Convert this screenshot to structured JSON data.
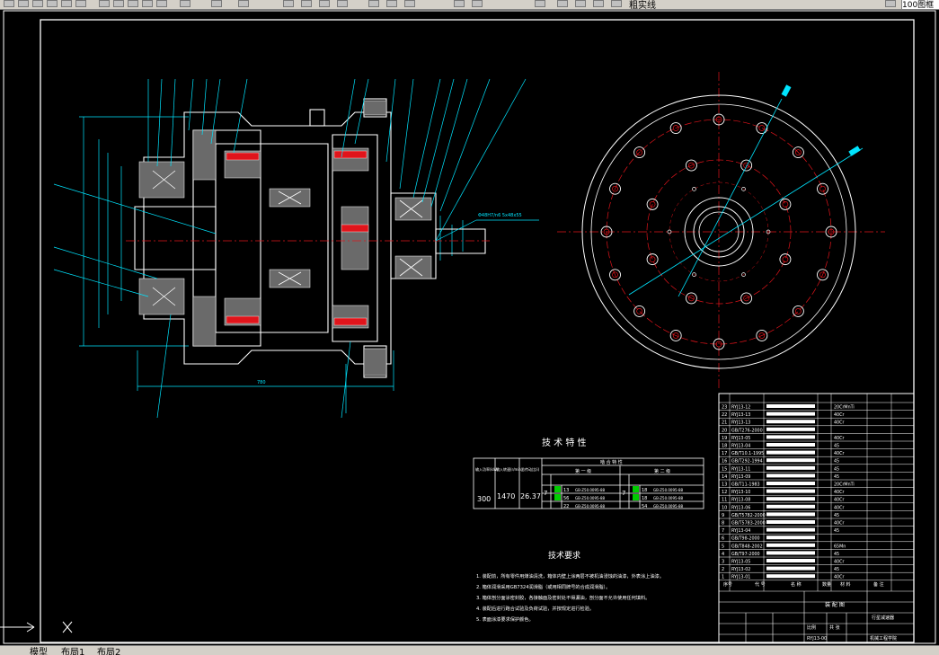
{
  "toolbar": {
    "layer_name": "粗实线",
    "zoom_value": "100图框"
  },
  "tabs": [
    "模型",
    "布局1",
    "布局2"
  ],
  "drawing": {
    "params_title": "技 术 特 性",
    "params_headers": {
      "input_power": "输入功率(kW)",
      "input_speed": "输入转速(r/min)",
      "ratio": "总传动比(i)",
      "meshing": "啮 合 特 性",
      "stage1": "第 一 级",
      "stage2": "第 二 级"
    },
    "params_values": {
      "input_power": "300",
      "input_speed": "1470",
      "ratio": "26.37",
      "stage1_ratio": "7",
      "stage2_ratio": "7",
      "stage1_rows": [
        {
          "z": "13",
          "spec": "GB-Z50.0095-88"
        },
        {
          "z": "56",
          "spec": "GB-Z50.0095-88"
        },
        {
          "z": "22",
          "spec": "GB-Z50.0095-88"
        }
      ],
      "stage2_rows": [
        {
          "z": "18",
          "spec": "GB-Z50.0095-88"
        },
        {
          "z": "18",
          "spec": "GB-Z50.0095-88"
        },
        {
          "z": "54",
          "spec": "GB-Z50.0095-88"
        }
      ]
    },
    "tech_req_title": "技术要求",
    "tech_req_items": [
      "1. 装配前，所有零件用煤油清洗，箱体内壁上涂两层不被机油浸蚀的油漆，外表涂上油漆。",
      "2. 箱体润滑采用GB7324润滑脂（或用相同牌号的合成润滑脂）。",
      "3. 箱体剖分面涂密封胶，各接触面及密封处不得漏油，剖分面不允许使用任何填料。",
      "4. 装配后进行跑合试验及负荷试验，并按规定进行检验。",
      "5. 表面涂漆要求保护颜色。"
    ],
    "leader_annotation": "Φ48H7/n6  5x48x55",
    "dimension_labels": [
      "780",
      "2"
    ],
    "bom_rows": [
      {
        "no": "23",
        "code": "RYJ13-12",
        "material": "20CrMnTi"
      },
      {
        "no": "22",
        "code": "RYJ13-13",
        "material": "40Cr"
      },
      {
        "no": "21",
        "code": "RYJ13-13",
        "material": "40Cr"
      },
      {
        "no": "20",
        "code": "GB/T276-2000",
        "material": ""
      },
      {
        "no": "19",
        "code": "RYJ13-05",
        "material": "40Cr"
      },
      {
        "no": "18",
        "code": "RYJ13-04",
        "material": "45"
      },
      {
        "no": "17",
        "code": "GB/T10.1-1995",
        "material": "40Cr"
      },
      {
        "no": "16",
        "code": "GB/T292-1994",
        "material": "45"
      },
      {
        "no": "15",
        "code": "RYJ13-11",
        "material": "45"
      },
      {
        "no": "14",
        "code": "RYJ13-09",
        "material": "45"
      },
      {
        "no": "13",
        "code": "GB/T11-1983",
        "material": "20CrMnTi"
      },
      {
        "no": "12",
        "code": "RYJ13-10",
        "material": "40Cr"
      },
      {
        "no": "11",
        "code": "RYJ13-08",
        "material": "40Cr"
      },
      {
        "no": "10",
        "code": "RYJ13-06",
        "material": "40Cr"
      },
      {
        "no": "9",
        "code": "GB/T5782-2000",
        "material": "45"
      },
      {
        "no": "8",
        "code": "GB/T5783-2000",
        "material": "40Cr"
      },
      {
        "no": "7",
        "code": "RYJ13-04",
        "material": "45"
      },
      {
        "no": "6",
        "code": "GB/T98-2000",
        "material": ""
      },
      {
        "no": "5",
        "code": "GB/T848-2002",
        "material": "65Mn"
      },
      {
        "no": "4",
        "code": "GB/T97-2000",
        "material": "45"
      },
      {
        "no": "3",
        "code": "RYJ13-05",
        "material": "40Cr"
      },
      {
        "no": "2",
        "code": "RYJ13-02",
        "material": "45"
      },
      {
        "no": "1",
        "code": "RYJ13-01",
        "material": "40Cr"
      }
    ],
    "bom_header": {
      "no": "序号",
      "code": "代 号",
      "name": "名 称",
      "qty": "数量",
      "material": "材 料",
      "note": "备 注"
    },
    "title_block": {
      "drawing_name": "行星减速器",
      "assembly": "装 配 图",
      "scale": "比例",
      "sheet": "共 张",
      "code": "RYJ13-00",
      "company": "机械工程学院"
    }
  }
}
